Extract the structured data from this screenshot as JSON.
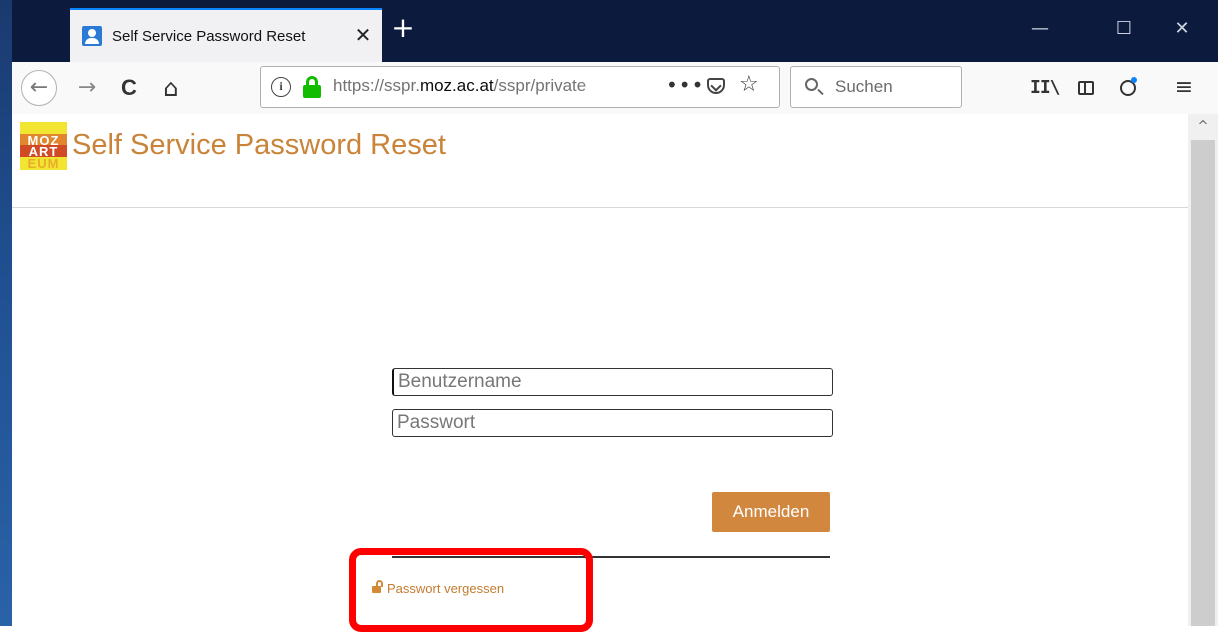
{
  "browser": {
    "tab_title": "Self Service Password Reset",
    "tab_close": "✕",
    "new_tab": "+",
    "window_controls": {
      "minimize": "—",
      "maximize": "☐",
      "close": "✕"
    },
    "nav": {
      "back": "←",
      "forward": "→",
      "reload": "C",
      "home": "⌂"
    },
    "url": {
      "prefix": "https://sspr.",
      "domain": "moz.ac.at",
      "path": "/sspr/private"
    },
    "url_more": "•••",
    "url_star": "☆",
    "search_placeholder": "Suchen",
    "toolbar": {
      "library": "II\\",
      "menu": "≡"
    }
  },
  "page": {
    "logo_lines": [
      "",
      "MOZ",
      "ART",
      "EUM"
    ],
    "title": "Self Service Password Reset",
    "form": {
      "username_placeholder": "Benutzername",
      "password_placeholder": "Passwort",
      "login_label": "Anmelden",
      "forgot_label": "Passwort vergessen"
    }
  },
  "scrollbar": {
    "up_arrow": "^"
  },
  "colors": {
    "brand": "#c98439",
    "button": "#d1883e",
    "highlight": "#ff0000",
    "titlebar": "#0c1a3d"
  }
}
